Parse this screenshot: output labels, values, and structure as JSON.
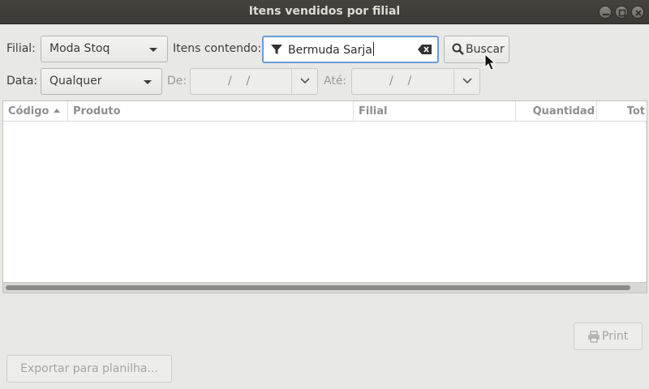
{
  "window": {
    "title": "Itens vendidos por filial"
  },
  "filters": {
    "branch_label": "Filial:",
    "branch_value": "Moda Stoq",
    "items_label": "Itens contendo:",
    "search_value": "Bermuda Sarja",
    "search_button": "Buscar",
    "date_label": "Data:",
    "date_value": "Qualquer",
    "from_label": "De:",
    "from_value": "/    /",
    "to_label": "Até:",
    "to_value": "/    /"
  },
  "table": {
    "columns": [
      "Código",
      "Produto",
      "Filial",
      "Quantidad",
      "Tot"
    ],
    "sorted_column": "Código",
    "sort_direction": "ascending",
    "rows": []
  },
  "footer": {
    "print_label": "Print",
    "export_label": "Exportar para planilha..."
  },
  "icons": [
    "close-icon",
    "minimize-icon",
    "maximize-icon",
    "filter-icon",
    "clear-text-icon",
    "search-icon",
    "chevron-down-icon",
    "printer-icon",
    "mouse-cursor-icon"
  ],
  "colors": {
    "titlebar": "#3c3b37",
    "focus_border": "#6b9bd6",
    "window_bg": "#e8e8e7"
  }
}
